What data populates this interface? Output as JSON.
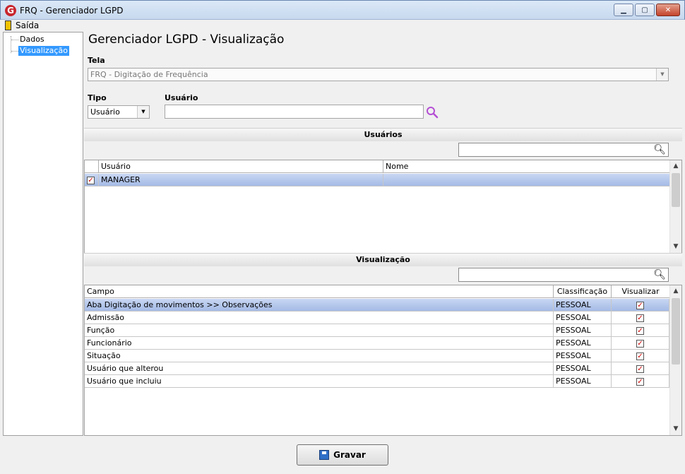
{
  "window": {
    "title": "FRQ - Gerenciador LGPD",
    "app_icon_letter": "G"
  },
  "menu": {
    "exit_label": "Saída"
  },
  "tree": {
    "items": [
      {
        "label": "Dados"
      },
      {
        "label": "Visualização",
        "selected": true
      }
    ]
  },
  "page": {
    "title": "Gerenciador LGPD - Visualização"
  },
  "form": {
    "tela_label": "Tela",
    "tela_value": "FRQ - Digitação de Frequência",
    "tipo_label": "Tipo",
    "tipo_value": "Usuário",
    "usuario_label": "Usuário",
    "usuario_value": ""
  },
  "users_section": {
    "title": "Usuários",
    "search_value": "",
    "columns": [
      "Usuário",
      "Nome"
    ],
    "rows": [
      {
        "checked": true,
        "usuario": "MANAGER",
        "nome": ""
      }
    ]
  },
  "visualizacao_section": {
    "title": "Visualização",
    "search_value": "",
    "columns": [
      "Campo",
      "Classificação",
      "Visualizar"
    ],
    "rows": [
      {
        "campo": "Aba Digitação de movimentos >> Observações",
        "classificacao": "PESSOAL",
        "visualizar": true
      },
      {
        "campo": "Admissão",
        "classificacao": "PESSOAL",
        "visualizar": true
      },
      {
        "campo": "Função",
        "classificacao": "PESSOAL",
        "visualizar": true
      },
      {
        "campo": "Funcionário",
        "classificacao": "PESSOAL",
        "visualizar": true
      },
      {
        "campo": "Situação",
        "classificacao": "PESSOAL",
        "visualizar": true
      },
      {
        "campo": "Usuário que alterou",
        "classificacao": "PESSOAL",
        "visualizar": true
      },
      {
        "campo": "Usuário que incluiu",
        "classificacao": "PESSOAL",
        "visualizar": true
      }
    ]
  },
  "footer": {
    "save_label": "Gravar"
  },
  "colors": {
    "selection": "#3399ff",
    "row_selected": "#a5bbe6",
    "checkmark": "#cc0000",
    "search_icon": "#b44fd4"
  }
}
